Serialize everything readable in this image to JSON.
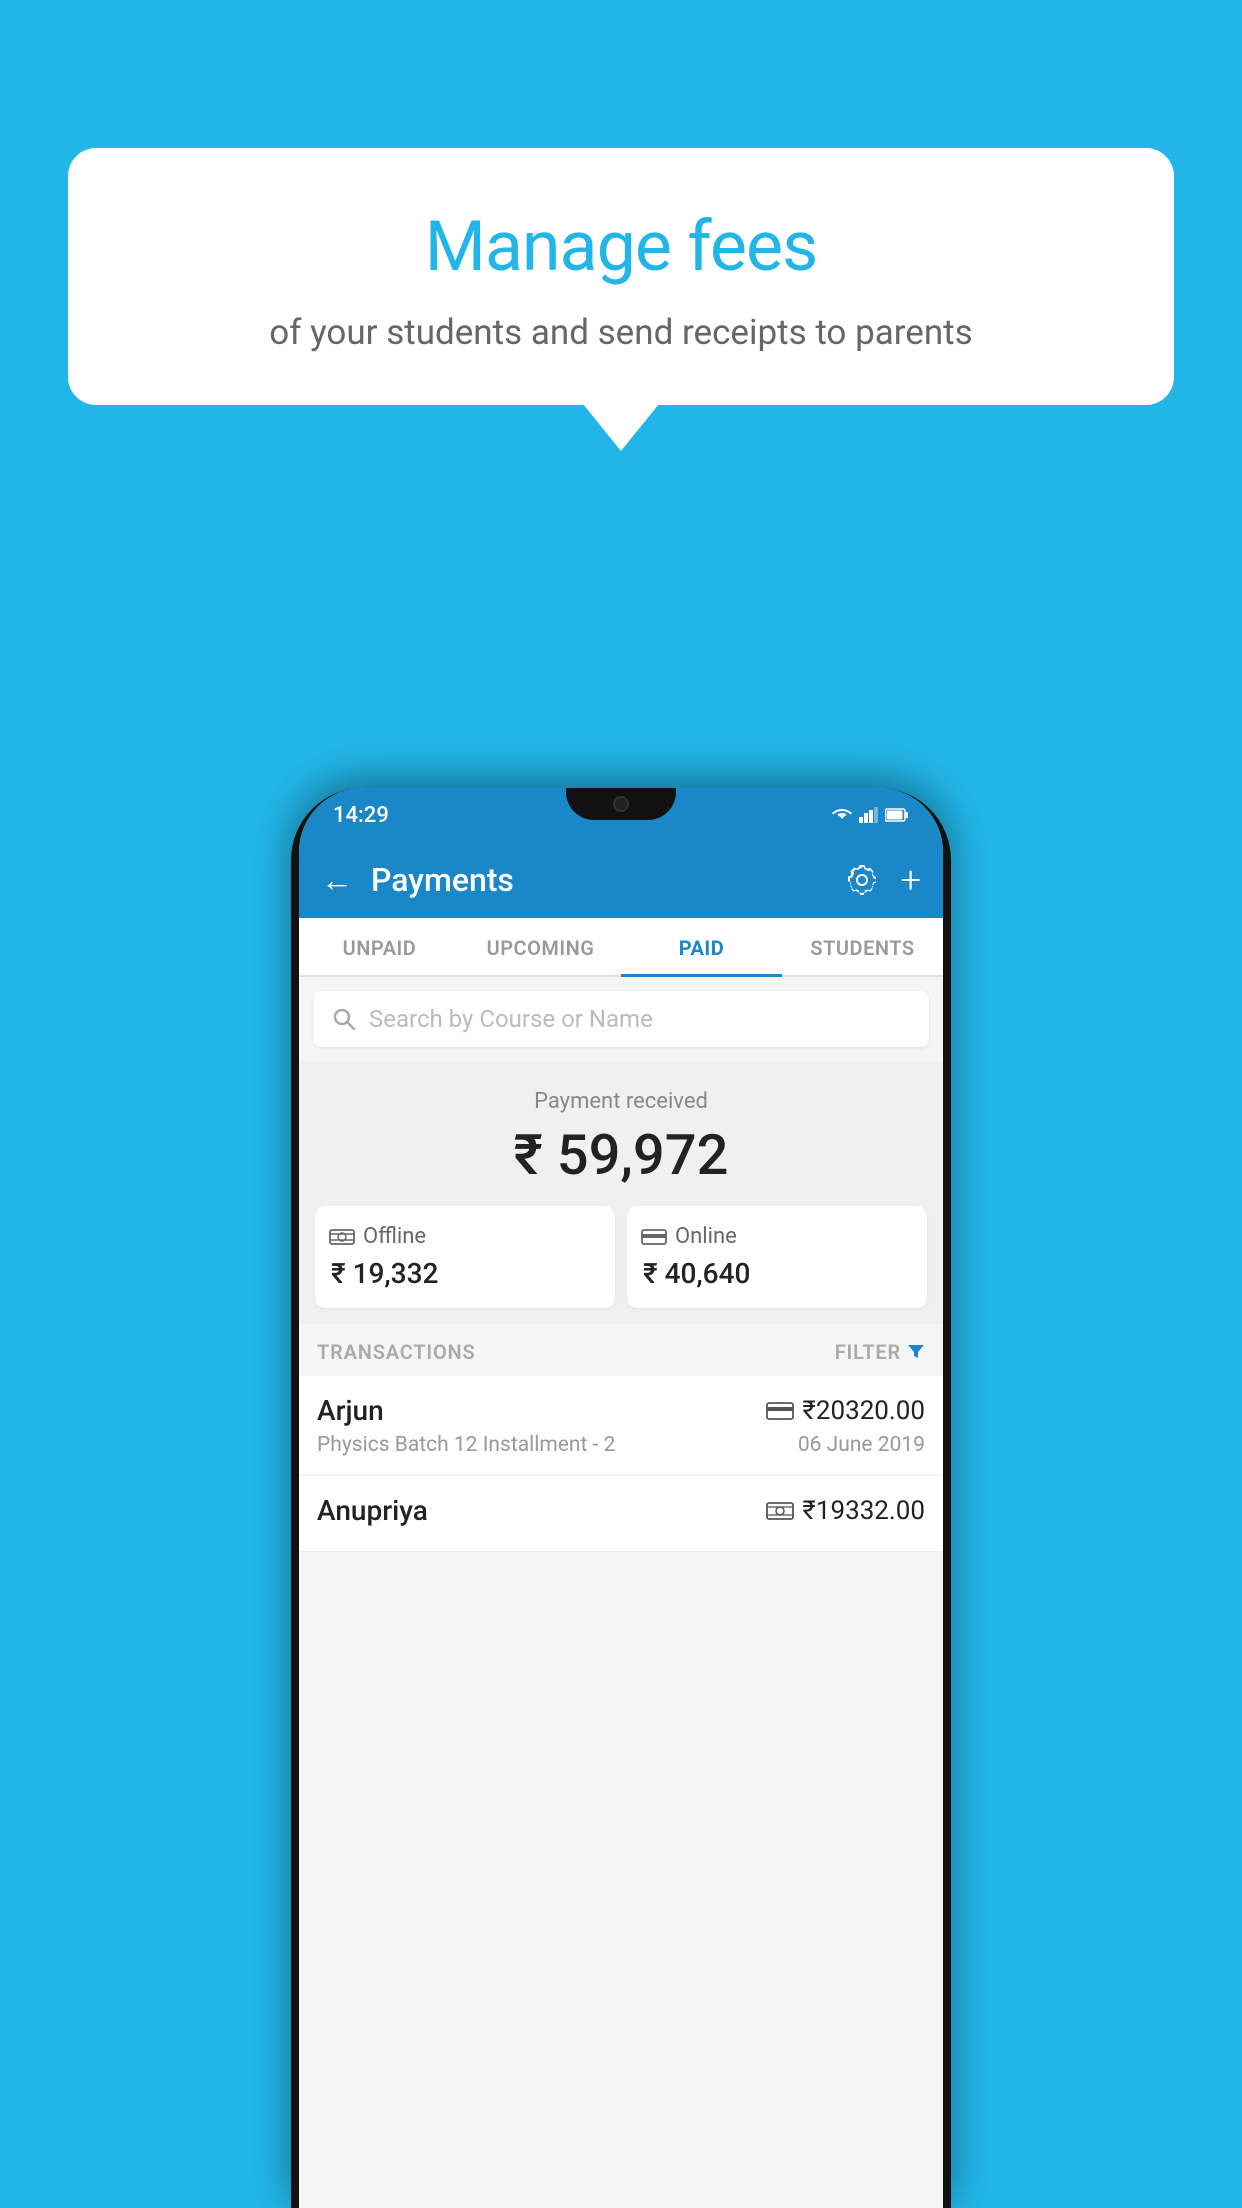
{
  "background": {
    "color": "#22b5e8"
  },
  "speech_bubble": {
    "title": "Manage fees",
    "subtitle": "of your students and send receipts to parents"
  },
  "status_bar": {
    "time": "14:29",
    "wifi": "▲",
    "signal": "▲",
    "battery": "▮"
  },
  "app_bar": {
    "title": "Payments",
    "back_label": "←",
    "gear_label": "⚙",
    "plus_label": "+"
  },
  "tabs": [
    {
      "id": "unpaid",
      "label": "UNPAID",
      "active": false
    },
    {
      "id": "upcoming",
      "label": "UPCOMING",
      "active": false
    },
    {
      "id": "paid",
      "label": "PAID",
      "active": true
    },
    {
      "id": "students",
      "label": "STUDENTS",
      "active": false
    }
  ],
  "search": {
    "placeholder": "Search by Course or Name"
  },
  "payment_summary": {
    "label": "Payment received",
    "amount": "₹ 59,972",
    "offline": {
      "icon": "💳",
      "label": "Offline",
      "amount": "₹ 19,332"
    },
    "online": {
      "icon": "💳",
      "label": "Online",
      "amount": "₹ 40,640"
    }
  },
  "transactions": {
    "label": "TRANSACTIONS",
    "filter_label": "FILTER",
    "rows": [
      {
        "name": "Arjun",
        "course": "Physics Batch 12 Installment - 2",
        "amount": "₹20320.00",
        "date": "06 June 2019",
        "type": "online"
      },
      {
        "name": "Anupriya",
        "course": "",
        "amount": "₹19332.00",
        "date": "",
        "type": "offline"
      }
    ]
  }
}
